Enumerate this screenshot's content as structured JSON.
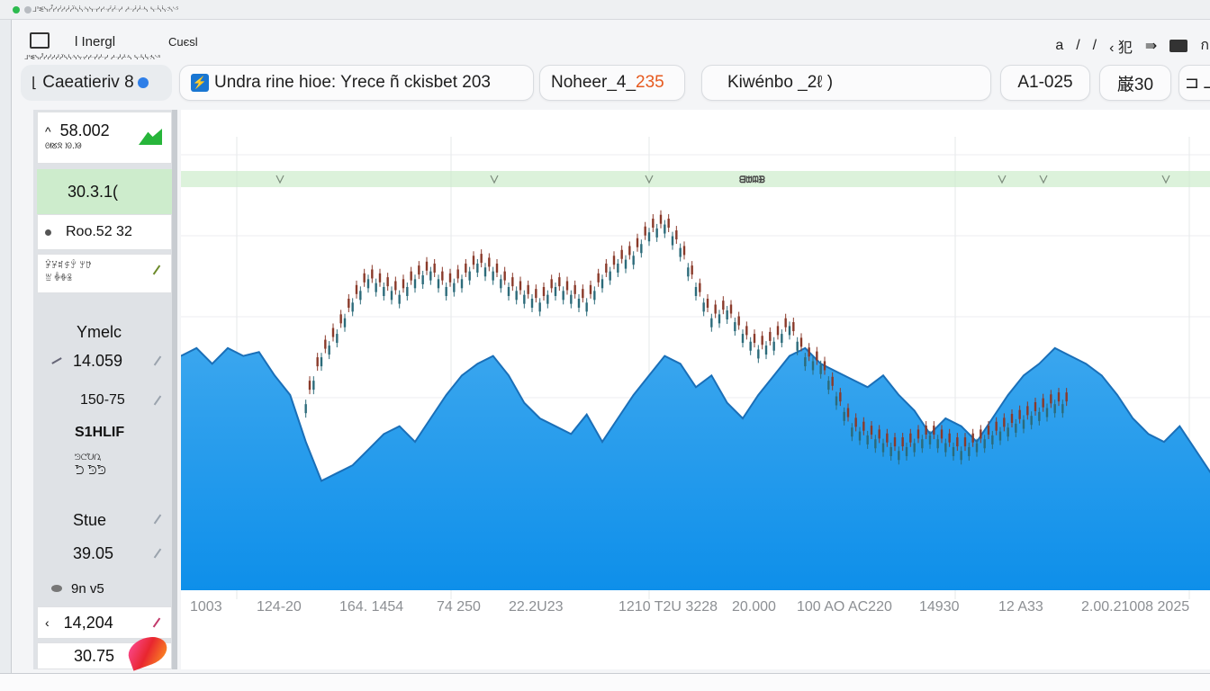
{
  "window": {
    "title": "l Inergl",
    "caption": "Cuєsl",
    "micro": "ᒧᓫᓬᓭᓮᓯᓰᓱᓲᓳᓴᓵᓶᓷᓸᓹᓺᓻᓼ ᓽᓾᓿᔀ ᔁᔂᔃᔄᔅᔆ"
  },
  "tools": [
    "a",
    "/",
    "/",
    "‹ 犯",
    "⇛",
    "",
    "ก"
  ],
  "tabs": [
    {
      "text": "Caeatieriv 8",
      "icon": "caret-left-icon"
    },
    {
      "text": "Undra rine hioe:  Yrece ñ ckisbet 203",
      "icon": "chart-icon"
    },
    {
      "text_a": "Noheer_4_",
      "text_b": "235"
    },
    {
      "text": "Kiwénbo _2ℓ )"
    },
    {
      "text": "A1-025"
    },
    {
      "text": "巌30"
    },
    {
      "text": "⊐ ⅃"
    }
  ],
  "sidebar": {
    "items": [
      {
        "label": "58.002",
        "sub": "ᘛᘜᘝ ᘞ.ᘟ"
      },
      {
        "label": "30.3.1(",
        "style": "green"
      },
      {
        "label": "Roo.52 32",
        "bullet": true
      },
      {
        "label": "ꐮꐯꐰꐱꐲ ꐳꐴ",
        "sub": "ꐵ ꐶꐷꐸ"
      },
      {
        "label": "Ymelc"
      },
      {
        "label": "14.059"
      },
      {
        "label": "150-75"
      },
      {
        "label": "S1HLIF"
      },
      {
        "label": "ᘦᘧᘨᘩ",
        "sub": "ᘪ ᘫᘬ"
      },
      {
        "label": "Stue"
      },
      {
        "label": "39.05"
      },
      {
        "label": "9n v5"
      },
      {
        "label": "14,204"
      },
      {
        "label": "30.75"
      }
    ]
  },
  "chart_data": {
    "type": "area",
    "header_label": "ᗺᗻᗼᗽ",
    "xlabels": [
      "1003",
      "124-20",
      "164. 1454",
      "74 250",
      "22.2U23",
      "1210 T2U 3228",
      "20.000",
      "100 AO AC220",
      "14930",
      "12 A33",
      "2.00.21008  2025"
    ],
    "area": {
      "color": "#1e96ef",
      "values": [
        60,
        62,
        58,
        62,
        60,
        61,
        55,
        50,
        38,
        28,
        30,
        32,
        36,
        40,
        42,
        38,
        44,
        50,
        55,
        58,
        60,
        55,
        48,
        44,
        42,
        40,
        45,
        38,
        44,
        50,
        55,
        60,
        58,
        52,
        55,
        48,
        44,
        50,
        55,
        60,
        62,
        58,
        56,
        54,
        52,
        55,
        50,
        46,
        40,
        44,
        42,
        38,
        44,
        50,
        55,
        58,
        62,
        60,
        58,
        55,
        50,
        44,
        40,
        38,
        42,
        36,
        30
      ]
    },
    "candles": {
      "color": "#2c6b7a",
      "values": [
        null,
        null,
        null,
        null,
        null,
        null,
        null,
        null,
        48,
        60,
        66,
        74,
        80,
        78,
        76,
        80,
        82,
        78,
        80,
        84,
        82,
        78,
        76,
        74,
        78,
        76,
        74,
        80,
        84,
        86,
        92,
        94,
        88,
        78,
        70,
        72,
        66,
        62,
        64,
        68,
        60,
        58,
        50,
        42,
        40,
        38,
        36,
        38,
        40,
        38,
        36,
        38,
        40,
        42,
        44,
        46,
        48,
        null,
        null,
        null,
        null,
        null,
        null,
        null,
        null,
        null,
        null
      ]
    }
  },
  "colors": {
    "accent_blue": "#1e96ef",
    "green_band": "#cdeccc",
    "orange_text": "#e65a1f"
  }
}
